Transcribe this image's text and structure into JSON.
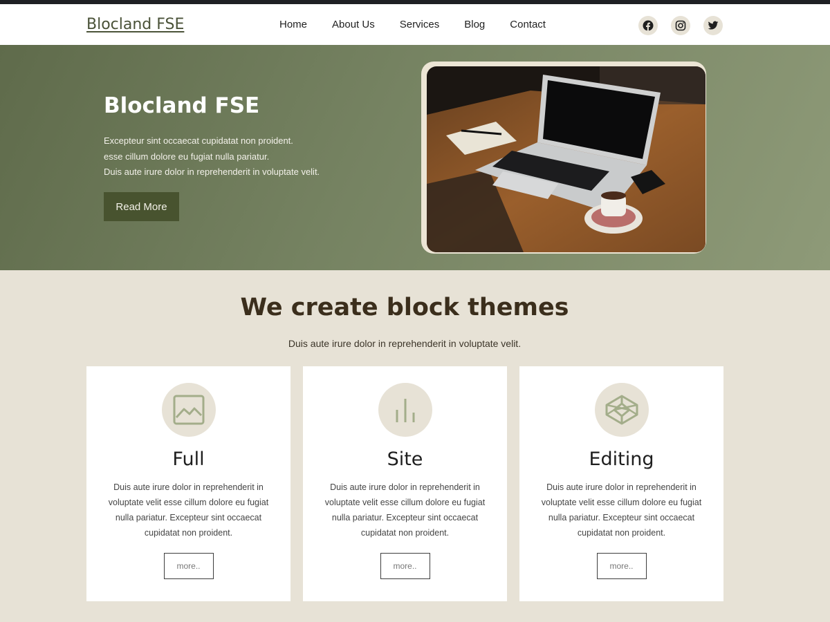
{
  "header": {
    "site_title": "Blocland FSE",
    "nav": [
      "Home",
      "About Us",
      "Services",
      "Blog",
      "Contact"
    ],
    "social": [
      "facebook-icon",
      "instagram-icon",
      "twitter-icon"
    ]
  },
  "hero": {
    "title": "Blocland FSE",
    "lines": [
      "Excepteur sint occaecat cupidatat non proident.",
      "esse cillum dolore eu fugiat nulla pariatur.",
      "Duis aute irure dolor in reprehenderit in voluptate velit."
    ],
    "button": "Read More"
  },
  "section": {
    "title": "We create block themes",
    "subtitle": "Duis aute irure dolor in reprehenderit in voluptate velit.",
    "cards": [
      {
        "icon": "image-icon",
        "title": "Full",
        "text": "Duis aute irure dolor in reprehenderit in voluptate velit esse cillum dolore eu fugiat nulla pariatur. Excepteur sint occaecat cupidatat non proident.",
        "button": "more.."
      },
      {
        "icon": "bar-chart-icon",
        "title": "Site",
        "text": "Duis aute irure dolor in reprehenderit in voluptate velit esse cillum dolore eu fugiat nulla pariatur. Excepteur sint occaecat cupidatat non proident.",
        "button": "more.."
      },
      {
        "icon": "codepen-icon",
        "title": "Editing",
        "text": "Duis aute irure dolor in reprehenderit in voluptate velit esse cillum dolore eu fugiat nulla pariatur. Excepteur sint occaecat cupidatat non proident.",
        "button": "more.."
      }
    ]
  },
  "colors": {
    "hero_bg": "#768362",
    "button_bg": "#48532f",
    "page_bg": "#e7e2d6",
    "icon_stroke": "#a3ad8a"
  }
}
